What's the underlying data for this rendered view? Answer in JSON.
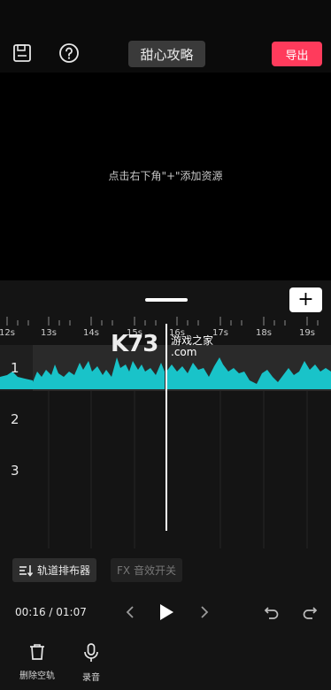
{
  "header": {
    "project_title": "甜心攻略",
    "export_label": "导出",
    "save_icon": "save-icon",
    "help_icon": "help-icon"
  },
  "preview": {
    "hint": "点击右下角\"+\"添加资源"
  },
  "timeline": {
    "add_track_label": "+",
    "ruler_labels": [
      "12s",
      "13s",
      "14s",
      "15s",
      "16s",
      "17s",
      "18s",
      "19s"
    ],
    "tracks": [
      {
        "number": "1",
        "has_audio": true
      },
      {
        "number": "2",
        "has_audio": false
      },
      {
        "number": "3",
        "has_audio": false
      }
    ],
    "waveform_color": "#19c3c9"
  },
  "watermark": {
    "logo": "K73",
    "tagline": "游戏之家",
    "domain": ".com"
  },
  "toolbar": {
    "track_arranger_label": "轨道排布器",
    "fx_toggle_label": "FX 音效开关"
  },
  "playback": {
    "current_time": "00:16",
    "total_time": "01:07",
    "time_text": "00:16 / 01:07"
  },
  "bottom_tools": [
    {
      "label": "删除空轨",
      "icon": "trash-icon"
    },
    {
      "label": "录音",
      "icon": "microphone-icon"
    }
  ]
}
